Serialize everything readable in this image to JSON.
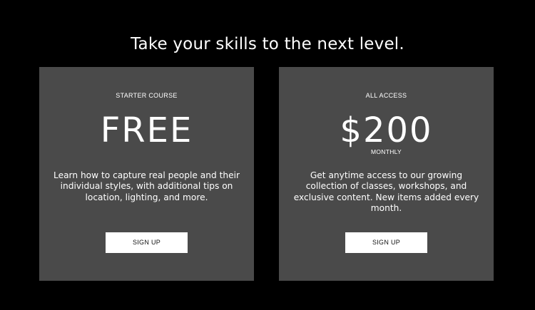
{
  "headline": "Take your skills to the next level.",
  "plans": [
    {
      "eyebrow": "STARTER COURSE",
      "price": "FREE",
      "period": "",
      "description": "Learn how to capture real people and their individual styles, with additional tips on location, lighting, and more.",
      "button_label": "SIGN UP"
    },
    {
      "eyebrow": "ALL ACCESS",
      "price": "$200",
      "period": "MONTHLY",
      "description": "Get anytime access to our growing collection of classes, workshops, and exclusive content. New items added every month.",
      "button_label": "SIGN UP"
    }
  ],
  "colors": {
    "background": "#000000",
    "card": "#4a4a4a",
    "text": "#ffffff",
    "button_bg": "#ffffff",
    "button_text": "#111111"
  }
}
